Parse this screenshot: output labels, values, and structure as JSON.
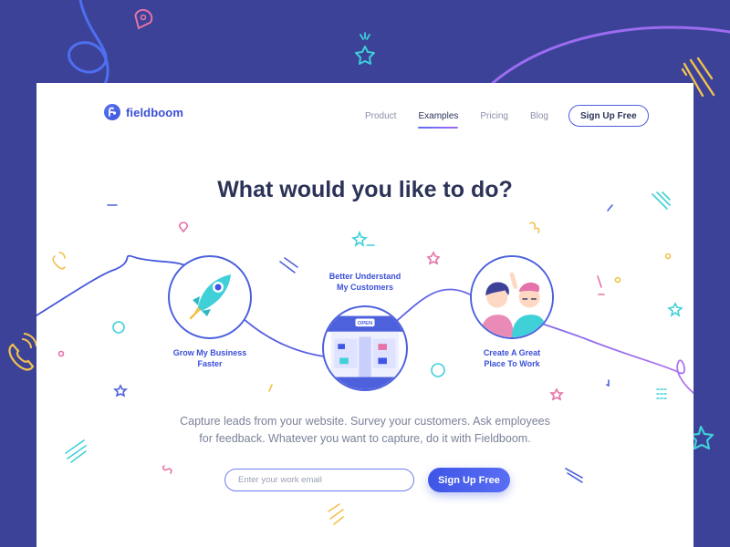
{
  "brand": {
    "name": "fieldboom"
  },
  "nav": {
    "links": [
      "Product",
      "Examples",
      "Pricing",
      "Blog"
    ],
    "active": "Examples",
    "signup_label": "Sign Up Free"
  },
  "hero": {
    "headline": "What would you like to do?",
    "options": [
      {
        "line1": "Grow My Business",
        "line2": "Faster",
        "icon": "rocket-icon"
      },
      {
        "line1": "Better Understand",
        "line2": "My Customers",
        "icon": "storefront-icon",
        "sign": "OPEN"
      },
      {
        "line1": "Create A Great",
        "line2": "Place To Work",
        "icon": "employees-icon"
      }
    ],
    "description": "Capture leads from your website. Survey your customers. Ask employees for feedback. Whatever you want to capture, do it with Fieldboom."
  },
  "signup_form": {
    "email_placeholder": "Enter your work email",
    "button_label": "Sign Up Free"
  },
  "colors": {
    "background": "#3b4297",
    "primary": "#3e55e6",
    "heading": "#2b3358",
    "accent_purple": "#a36af0",
    "accent_teal": "#3fd0d8",
    "accent_yellow": "#f2c14e",
    "accent_pink": "#e572a8"
  }
}
